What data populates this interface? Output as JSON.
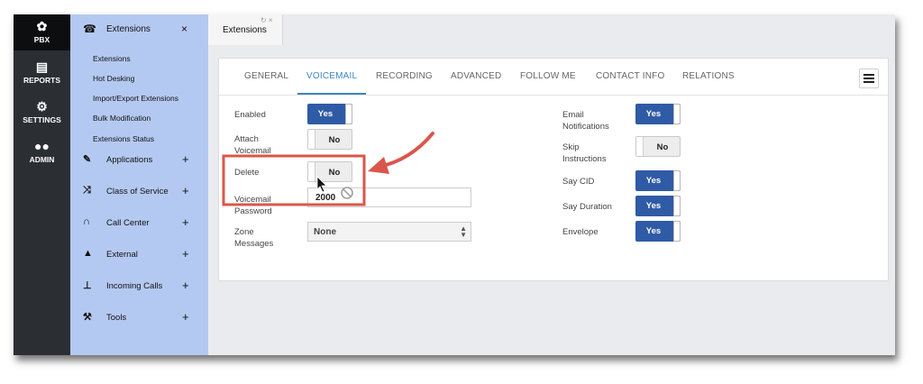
{
  "rail": {
    "items": [
      {
        "label": "PBX",
        "icon": "gear-icon",
        "active": true
      },
      {
        "label": "REPORTS",
        "icon": "report-icon"
      },
      {
        "label": "SETTINGS",
        "icon": "cogs-icon"
      },
      {
        "label": "ADMIN",
        "icon": "users-icon"
      }
    ]
  },
  "sidebar": {
    "header": {
      "label": "Extensions",
      "close": "×"
    },
    "subitems": [
      "Extensions",
      "Hot Desking",
      "Import/Export Extensions",
      "Bulk Modification",
      "Extensions Status"
    ],
    "groups": [
      {
        "label": "Applications",
        "expand": "+"
      },
      {
        "label": "Class of Service",
        "expand": "+"
      },
      {
        "label": "Call Center",
        "expand": "+"
      },
      {
        "label": "External",
        "expand": "+"
      },
      {
        "label": "Incoming Calls",
        "expand": "+"
      },
      {
        "label": "Tools",
        "expand": "+"
      }
    ]
  },
  "doc_tab": {
    "label": "Extensions",
    "controls": "↻ ×"
  },
  "tabs": [
    "GENERAL",
    "VOICEMAIL",
    "RECORDING",
    "ADVANCED",
    "FOLLOW ME",
    "CONTACT INFO",
    "RELATIONS"
  ],
  "active_tab": "VOICEMAIL",
  "form": {
    "left": {
      "enabled": {
        "label": "Enabled",
        "value": "Yes"
      },
      "attach": {
        "label": "Attach Voicemail",
        "value": "No"
      },
      "delete": {
        "label": "Delete",
        "value": "No"
      },
      "password": {
        "label": "Voicemail Password",
        "value": "2000"
      },
      "zone": {
        "label": "Zone Messages",
        "value": "None"
      }
    },
    "right": {
      "email": {
        "label": "Email Notifications",
        "value": "Yes"
      },
      "skip": {
        "label": "Skip Instructions",
        "value": "No"
      },
      "saycid": {
        "label": "Say CID",
        "value": "Yes"
      },
      "sayduration": {
        "label": "Say Duration",
        "value": "Yes"
      },
      "envelope": {
        "label": "Envelope",
        "value": "Yes"
      }
    }
  },
  "colors": {
    "accent": "#3e86c0",
    "toggle_on": "#2f5ba6",
    "sidebar_bg": "#b4c9f1",
    "rail_bg": "#2b2e33",
    "annotation": "#d9574a"
  }
}
